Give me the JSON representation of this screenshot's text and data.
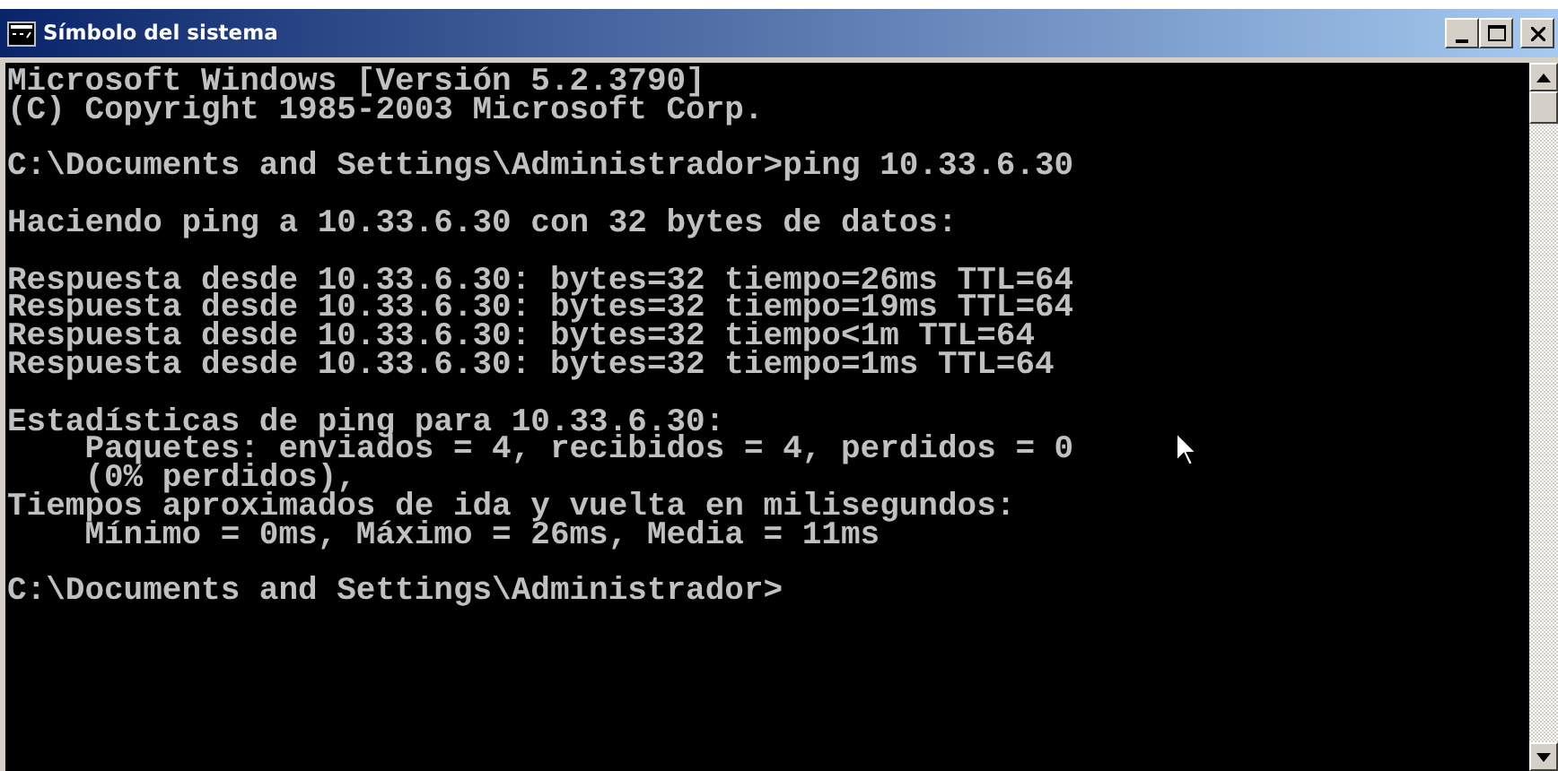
{
  "window": {
    "title": "Símbolo del sistema"
  },
  "console": {
    "blocks": [
      [
        "Microsoft Windows [Versión 5.2.3790]",
        "(C) Copyright 1985-2003 Microsoft Corp."
      ],
      [
        "C:\\Documents and Settings\\Administrador>ping 10.33.6.30"
      ],
      [
        "Haciendo ping a 10.33.6.30 con 32 bytes de datos:"
      ],
      [
        "Respuesta desde 10.33.6.30: bytes=32 tiempo=26ms TTL=64",
        "Respuesta desde 10.33.6.30: bytes=32 tiempo=19ms TTL=64",
        "Respuesta desde 10.33.6.30: bytes=32 tiempo<1m TTL=64",
        "Respuesta desde 10.33.6.30: bytes=32 tiempo=1ms TTL=64"
      ],
      [
        "Estadísticas de ping para 10.33.6.30:",
        "    Paquetes: enviados = 4, recibidos = 4, perdidos = 0",
        "    (0% perdidos),",
        "Tiempos aproximados de ida y vuelta en milisegundos:",
        "    Mínimo = 0ms, Máximo = 26ms, Media = 11ms"
      ],
      [
        "C:\\Documents and Settings\\Administrador>"
      ]
    ]
  }
}
